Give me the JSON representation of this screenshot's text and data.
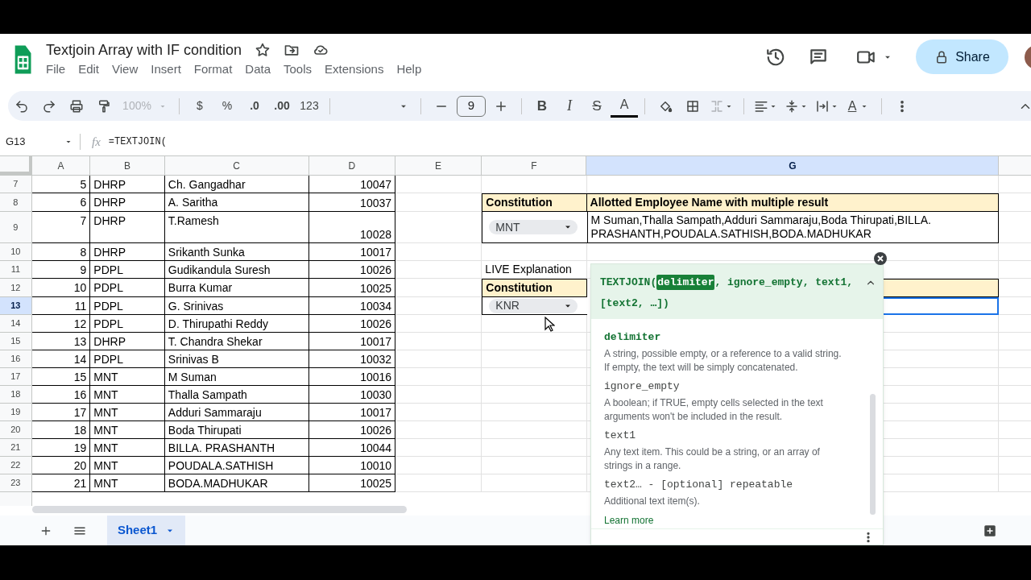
{
  "document": {
    "title": "Textjoin Array with IF condition"
  },
  "menu": [
    "File",
    "Edit",
    "View",
    "Insert",
    "Format",
    "Data",
    "Tools",
    "Extensions",
    "Help"
  ],
  "share": {
    "label": "Share"
  },
  "toolbar": [
    {
      "kind": "undo"
    },
    {
      "kind": "redo"
    },
    {
      "kind": "print"
    },
    {
      "kind": "paint"
    },
    {
      "kind": "zoom",
      "text": "100%"
    },
    {
      "kind": "sep"
    },
    {
      "kind": "text",
      "text": "$"
    },
    {
      "kind": "text",
      "text": "%"
    },
    {
      "kind": "decimal-down",
      "text": ".0"
    },
    {
      "kind": "decimal-up",
      "text": ".00"
    },
    {
      "kind": "text",
      "text": "123"
    },
    {
      "kind": "sep"
    },
    {
      "kind": "font"
    },
    {
      "kind": "sep"
    },
    {
      "kind": "minus"
    },
    {
      "kind": "size",
      "text": "9"
    },
    {
      "kind": "plus"
    },
    {
      "kind": "sep"
    },
    {
      "kind": "bold",
      "text": "B"
    },
    {
      "kind": "italic",
      "text": "I"
    },
    {
      "kind": "strike",
      "text": "S"
    },
    {
      "kind": "color",
      "text": "A"
    },
    {
      "kind": "sep"
    },
    {
      "kind": "fill"
    },
    {
      "kind": "borders"
    },
    {
      "kind": "merge"
    },
    {
      "kind": "sep"
    },
    {
      "kind": "align"
    },
    {
      "kind": "valign"
    },
    {
      "kind": "wrap"
    },
    {
      "kind": "rotate",
      "text": "A"
    },
    {
      "kind": "sep"
    },
    {
      "kind": "more"
    }
  ],
  "formula_bar": {
    "cell": "G13",
    "fx": "fx",
    "formula": "=TEXTJOIN("
  },
  "columns": [
    {
      "label": "A",
      "selected": false
    },
    {
      "label": "B",
      "selected": false
    },
    {
      "label": "C",
      "selected": false
    },
    {
      "label": "D",
      "selected": false
    },
    {
      "label": "E",
      "selected": false
    },
    {
      "label": "F",
      "selected": false
    },
    {
      "label": "G",
      "selected": true
    }
  ],
  "rows": [
    {
      "number": "7",
      "selected": false,
      "cells": [
        "5",
        "DHRP",
        "Ch. Gangadhar",
        "10047"
      ]
    },
    {
      "number": "8",
      "selected": false,
      "cells": [
        "6",
        "DHRP",
        "A. Saritha",
        "10037"
      ],
      "f": {
        "kind": "header",
        "text": "Constitution"
      },
      "g": {
        "kind": "header",
        "text": "Allotted Employee Name with multiple result"
      }
    },
    {
      "number": "9",
      "selected": false,
      "cells": [
        "7",
        "DHRP",
        "T.Ramesh",
        "10028"
      ],
      "f": {
        "kind": "dropdown",
        "text": "MNT"
      },
      "g": {
        "kind": "text",
        "text": "M Suman,Thalla Sampath,Adduri Sammaraju,Boda Thirupati,BILLA. PRASHANTH,POUDALA.SATHISH,BODA.MADHUKAR"
      }
    },
    {
      "number": "10",
      "selected": false,
      "cells": [
        "8",
        "DHRP",
        "Srikanth Sunka",
        "10017"
      ]
    },
    {
      "number": "11",
      "selected": false,
      "cells": [
        "9",
        "PDPL",
        "Gudikandula Suresh",
        "10026"
      ],
      "f": {
        "kind": "label",
        "text": "LIVE Explanation"
      }
    },
    {
      "number": "12",
      "selected": false,
      "cells": [
        "10",
        "PDPL",
        "Burra Kumar",
        "10025"
      ],
      "f": {
        "kind": "header",
        "text": "Constitution"
      },
      "g": {
        "kind": "band"
      }
    },
    {
      "number": "13",
      "selected": true,
      "cells": [
        "11",
        "PDPL",
        "G. Srinivas",
        "10034"
      ],
      "f": {
        "kind": "dropdown",
        "text": "KNR"
      },
      "g": {
        "kind": "active"
      }
    },
    {
      "number": "14",
      "selected": false,
      "cells": [
        "12",
        "PDPL",
        "D. Thirupathi Reddy",
        "10026"
      ]
    },
    {
      "number": "15",
      "selected": false,
      "cells": [
        "13",
        "DHRP",
        "T. Chandra Shekar",
        "10017"
      ]
    },
    {
      "number": "16",
      "selected": false,
      "cells": [
        "14",
        "PDPL",
        "Srinivas B",
        "10032"
      ]
    },
    {
      "number": "17",
      "selected": false,
      "cells": [
        "15",
        "MNT",
        "M Suman",
        "10016"
      ]
    },
    {
      "number": "18",
      "selected": false,
      "cells": [
        "16",
        "MNT",
        "Thalla Sampath",
        "10030"
      ]
    },
    {
      "number": "19",
      "selected": false,
      "cells": [
        "17",
        "MNT",
        "Adduri Sammaraju",
        "10017"
      ]
    },
    {
      "number": "20",
      "selected": false,
      "cells": [
        "18",
        "MNT",
        "Boda Thirupati",
        "10026"
      ]
    },
    {
      "number": "21",
      "selected": false,
      "cells": [
        "19",
        "MNT",
        "BILLA. PRASHANTH",
        "10044"
      ]
    },
    {
      "number": "22",
      "selected": false,
      "cells": [
        "20",
        "MNT",
        "POUDALA.SATHISH",
        "10010"
      ]
    },
    {
      "number": "23",
      "selected": false,
      "cells": [
        "21",
        "MNT",
        "BODA.MADHUKAR",
        "10025"
      ]
    }
  ],
  "tooltip": {
    "signature": [
      {
        "text": "TEXTJOIN(",
        "selected": false
      },
      {
        "text": "delimiter",
        "selected": true
      },
      {
        "text": ", ignore_empty, text1, [text2, …])",
        "selected": false
      }
    ],
    "params": [
      {
        "name": "delimiter",
        "selected": true,
        "description": "A string, possible empty, or a reference to a valid string. If empty, the text will be simply concatenated."
      },
      {
        "name": "ignore_empty",
        "selected": false,
        "description": "A boolean; if TRUE, empty cells selected in the text arguments won't be included in the result."
      },
      {
        "name": "text1",
        "selected": false,
        "description": "Any text item. This could be a string, or an array of strings in a range."
      },
      {
        "name": "text2… - [optional] repeatable",
        "selected": false,
        "description": "Additional text item(s)."
      }
    ],
    "link": "Learn more"
  },
  "sheets": [
    {
      "label": "Sheet1",
      "selected": true
    }
  ]
}
